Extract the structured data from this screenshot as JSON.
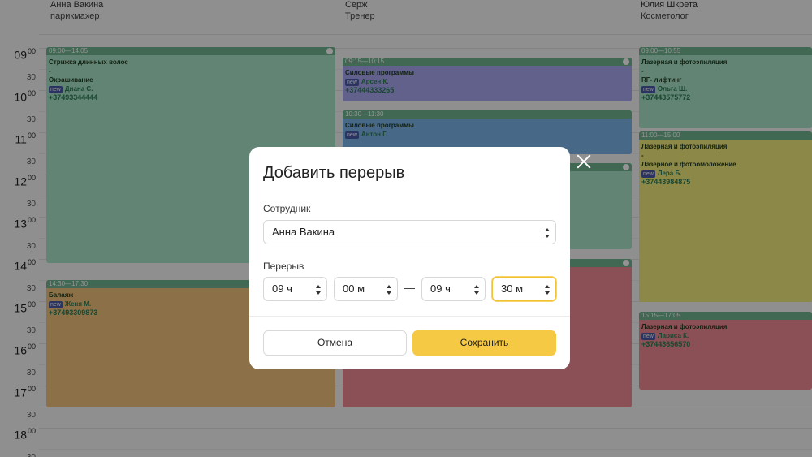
{
  "staff": [
    {
      "name": "Анна Вакина",
      "role": "парикмахер"
    },
    {
      "name": "Серж",
      "role": "Тренер"
    },
    {
      "name": "Юлия Шкрета",
      "role": "Косметолог"
    }
  ],
  "times": [
    {
      "h": "09",
      "m": "00"
    },
    {
      "half": "30"
    },
    {
      "h": "10",
      "m": "00"
    },
    {
      "half": "30"
    },
    {
      "h": "11",
      "m": "00"
    },
    {
      "half": "30"
    },
    {
      "h": "12",
      "m": "00"
    },
    {
      "half": "30"
    },
    {
      "h": "13",
      "m": "00"
    },
    {
      "half": "30"
    },
    {
      "h": "14",
      "m": "00"
    },
    {
      "half": "30"
    },
    {
      "h": "15",
      "m": "00"
    },
    {
      "half": "30"
    },
    {
      "h": "16",
      "m": "00"
    },
    {
      "half": "30"
    },
    {
      "h": "17",
      "m": "00"
    },
    {
      "half": "30"
    },
    {
      "h": "18",
      "m": "00"
    },
    {
      "half": "30"
    }
  ],
  "appointments": {
    "anna_1": {
      "time": "09:00—14:05",
      "service": "Стрижка длинных волос",
      "sep": "-",
      "service2": "Окрашивание",
      "badge": "new",
      "client": "Диана С.",
      "phone": "+37493344444"
    },
    "anna_2": {
      "time": "14:30—17:30",
      "service": "Балаяж",
      "badge": "new",
      "client": "Женя М.",
      "phone": "+37493309873"
    },
    "serge_1": {
      "time": "09:15—10:15",
      "service": "Силовые программы",
      "badge": "new",
      "client": "Арсен К.",
      "phone": "+37444333265"
    },
    "serge_2": {
      "time": "10:30—11:30",
      "service": "Силовые программы",
      "badge": "new",
      "client": "Антон Г."
    },
    "yulia_1": {
      "time": "09:00—10:55",
      "service": "Лазерная и фотоэпиляция",
      "sep": "-",
      "service2": "RF- лифтинг",
      "badge": "new",
      "client": "Ольга Ш.",
      "phone": "+37443575772"
    },
    "yulia_2": {
      "time": "11:00—15:00",
      "service": "Лазерная и фотоэпиляция",
      "sep": "-",
      "service2": "Лазерное и фотоомоложение",
      "badge": "new",
      "client": "Лера Б.",
      "phone": "+37443984875"
    },
    "yulia_3": {
      "time": "15:15—17:05",
      "service": "Лазерная и фотоэпиляция",
      "badge": "new",
      "client": "Лариса К.",
      "phone": "+37443656570"
    }
  },
  "modal": {
    "title": "Добавить перерыв",
    "employee_label": "Сотрудник",
    "employee_value": "Анна Вакина",
    "break_label": "Перерыв",
    "from_hours": "09 ч",
    "from_minutes": "00 м",
    "to_hours": "09 ч",
    "to_minutes": "30 м",
    "cancel_label": "Отмена",
    "save_label": "Сохранить"
  },
  "colors": {
    "header_bar": "#6fb38f",
    "mint": "#a9e3c8",
    "orange": "#f2c27a",
    "purple": "#a7a8ef",
    "blue": "#7ab3e8",
    "yellow": "#f1ea7c",
    "pink": "#f08a93",
    "save_button": "#f6c944"
  }
}
